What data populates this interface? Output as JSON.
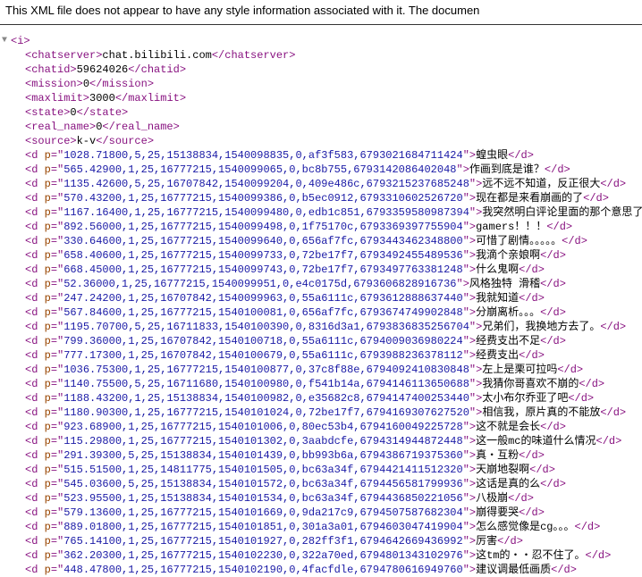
{
  "banner": "This XML file does not appear to have any style information associated with it. The documen",
  "root": {
    "tag": "i"
  },
  "meta": [
    {
      "tag": "chatserver",
      "text": "chat.bilibili.com"
    },
    {
      "tag": "chatid",
      "text": "59624026"
    },
    {
      "tag": "mission",
      "text": "0"
    },
    {
      "tag": "maxlimit",
      "text": "3000"
    },
    {
      "tag": "state",
      "text": "0"
    },
    {
      "tag": "real_name",
      "text": "0"
    },
    {
      "tag": "source",
      "text": "k-v"
    }
  ],
  "d": [
    {
      "p": "1028.71800,5,25,15138834,1540098835,0,af3f583,6793021684711424",
      "text": "蝗虫眼"
    },
    {
      "p": "565.42900,1,25,16777215,1540099065,0,bc8b755,6793142086402048",
      "text": "作画到底是谁？"
    },
    {
      "p": "1135.42600,5,25,16707842,1540099204,0,409e486c,6793215237685248",
      "text": "远不远不知道，反正很大"
    },
    {
      "p": "570.43200,1,25,16777215,1540099386,0,b5ec0912,6793310602526720",
      "text": "现在都是来看崩画的了"
    },
    {
      "p": "1167.16400,1,25,16777215,1540099480,0,edb1c851,6793359580987394",
      "text": "我突然明白评论里面的那个意思了"
    },
    {
      "p": "892.56000,1,25,16777215,1540099498,0,1f75170c,6793369397755904",
      "text": "gamers！！！"
    },
    {
      "p": "330.64600,1,25,16777215,1540099640,0,656af7fc,6793443462348800",
      "text": "可惜了剧情。。。。。"
    },
    {
      "p": "658.40600,1,25,16777215,1540099733,0,72be17f7,6793492455489536",
      "text": "我滴个亲娘啊"
    },
    {
      "p": "668.45000,1,25,16777215,1540099743,0,72be17f7,6793497763381248",
      "text": "什么鬼啊"
    },
    {
      "p": "52.36000,1,25,16777215,1540099951,0,e4c0175d,6793606828916736",
      "text": "风格独特 滑稽"
    },
    {
      "p": "247.24200,1,25,16707842,1540099963,0,55a6111c,6793612888637440",
      "text": "我就知道"
    },
    {
      "p": "567.84600,1,25,16777215,1540100081,0,656af7fc,6793674749902848",
      "text": "分崩离析。。。"
    },
    {
      "p": "1195.70700,5,25,16711833,1540100390,0,8316d3a1,6793836835256704",
      "text": "兄弟们，我换地方去了。"
    },
    {
      "p": "799.36000,1,25,16707842,1540100718,0,55a6111c,6794009036980224",
      "text": "经费支出不足"
    },
    {
      "p": "777.17300,1,25,16707842,1540100679,0,55a6111c,6793988236378112",
      "text": "经费支出"
    },
    {
      "p": "1036.75300,1,25,16777215,1540100877,0,37c8f88e,6794092410830848",
      "text": "左上是栗可拉吗"
    },
    {
      "p": "1140.75500,5,25,16711680,1540100980,0,f541b14a,6794146113650688",
      "text": "我猜你哥喜欢不崩的"
    },
    {
      "p": "1188.43200,1,25,15138834,1540100982,0,e35682c8,6794147400253440",
      "text": "太小布尔乔亚了吧"
    },
    {
      "p": "1180.90300,1,25,16777215,1540101024,0,72be17f7,6794169307627520",
      "text": "相信我，原片真的不能放"
    },
    {
      "p": "923.68900,1,25,16777215,1540101006,0,80ec53b4,6794160049225728",
      "text": "这不就是会长"
    },
    {
      "p": "115.29800,1,25,16777215,1540101302,0,3aabdcfe,6794314944872448",
      "text": "这一般mc的味道什么情况"
    },
    {
      "p": "291.39300,5,25,15138834,1540101439,0,bb993b6a,6794386719375360",
      "text": "真・互粉"
    },
    {
      "p": "515.51500,1,25,14811775,1540101505,0,bc63a34f,6794421411512320",
      "text": "天崩地裂啊"
    },
    {
      "p": "545.03600,5,25,15138834,1540101572,0,bc63a34f,6794456581799936",
      "text": "这话是真的么"
    },
    {
      "p": "523.95500,1,25,15138834,1540101534,0,bc63a34f,6794436850221056",
      "text": "八极崩"
    },
    {
      "p": "579.13600,1,25,16777215,1540101669,0,9da217c9,6794507587682304",
      "text": "崩得要哭"
    },
    {
      "p": "889.01800,1,25,16777215,1540101851,0,301a3a01,6794603047419904",
      "text": "怎么感觉像是cg。。。"
    },
    {
      "p": "765.14100,1,25,16777215,1540101927,0,282ff3f1,6794642669436992",
      "text": "厉害"
    },
    {
      "p": "362.20300,1,25,16777215,1540102230,0,322a70ed,6794801343102976",
      "text": "这tm的・・忍不住了。"
    },
    {
      "p": "448.47800,1,25,16777215,1540102190,0,4facfdle,6794780616949760",
      "text": "建议调最低画质"
    }
  ]
}
